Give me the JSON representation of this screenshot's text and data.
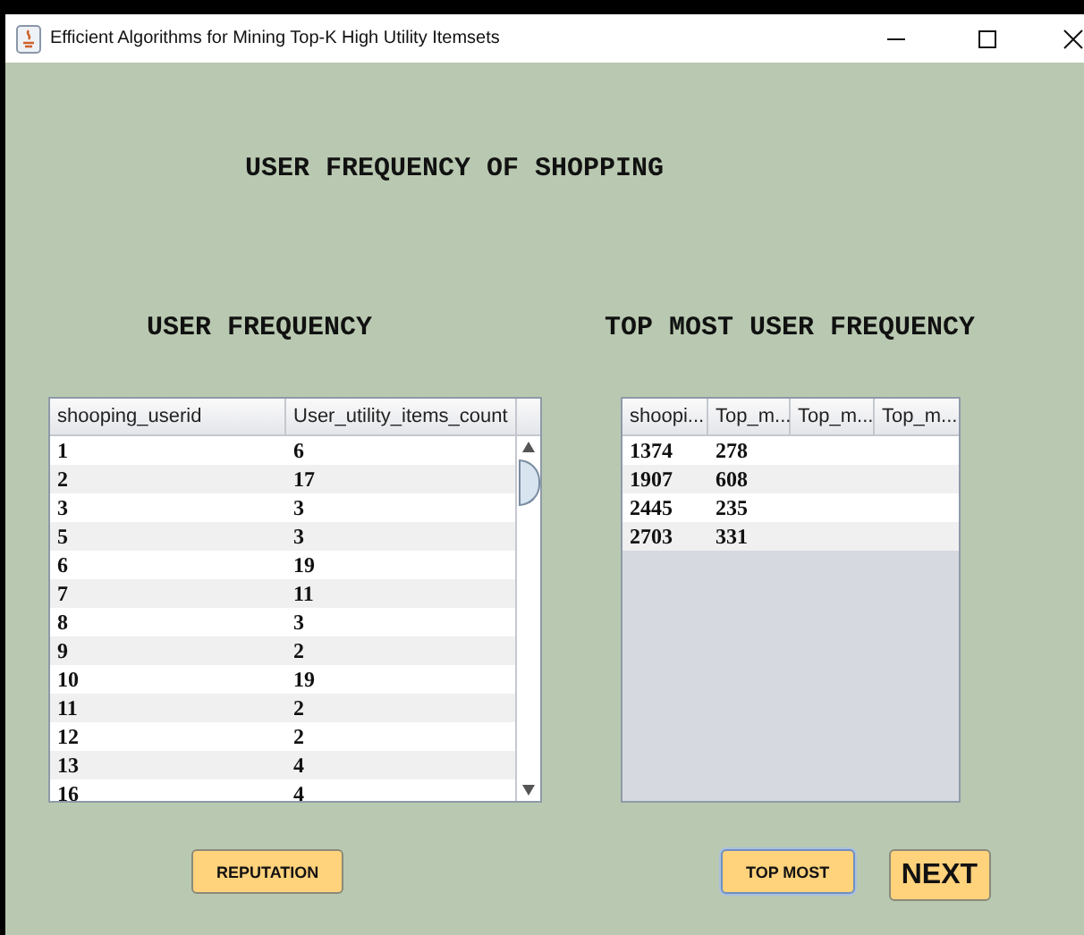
{
  "window": {
    "title": "Efficient Algorithms for Mining Top-K High Utility Itemsets"
  },
  "heading": "USER FREQUENCY OF SHOPPING",
  "user_frequency": {
    "title": "USER FREQUENCY",
    "columns": [
      "shooping_userid",
      "User_utility_items_count"
    ],
    "rows": [
      [
        "1",
        "6"
      ],
      [
        "2",
        "17"
      ],
      [
        "3",
        "3"
      ],
      [
        "5",
        "3"
      ],
      [
        "6",
        "19"
      ],
      [
        "7",
        "11"
      ],
      [
        "8",
        "3"
      ],
      [
        "9",
        "2"
      ],
      [
        "10",
        "19"
      ],
      [
        "11",
        "2"
      ],
      [
        "12",
        "2"
      ],
      [
        "13",
        "4"
      ],
      [
        "16",
        "4"
      ]
    ]
  },
  "top_most": {
    "title": "TOP MOST USER FREQUENCY",
    "columns": [
      "shoopi...",
      "Top_m...",
      "Top_m...",
      "Top_m..."
    ],
    "rows": [
      [
        "1374",
        "278"
      ],
      [
        "1907",
        "608"
      ],
      [
        "2445",
        "235"
      ],
      [
        "2703",
        "331"
      ]
    ]
  },
  "buttons": [
    {
      "label": "REPUTATION",
      "kind": "small",
      "focused": false
    },
    {
      "label": "TOP MOST",
      "kind": "small",
      "focused": true
    },
    {
      "label": "NEXT",
      "kind": "large",
      "focused": false
    }
  ]
}
